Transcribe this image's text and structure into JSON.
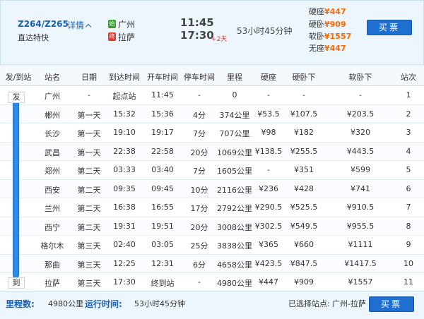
{
  "header": {
    "train_no": "Z264/Z265",
    "detail_link": "详情",
    "train_type": "直达特快",
    "start_badge": "始",
    "end_badge": "终",
    "start_station": "广州",
    "end_station": "拉萨",
    "dep_time": "11:45",
    "arr_time": "17:30",
    "plus_days": "+2天",
    "duration": "53小时45分钟",
    "prices": [
      {
        "label": "硬座",
        "value": "¥447"
      },
      {
        "label": "硬卧",
        "value": "¥909"
      },
      {
        "label": "软卧",
        "value": "¥1557"
      },
      {
        "label": "无座",
        "value": "¥447"
      }
    ],
    "buy_label": "买票"
  },
  "columns": [
    "发/到站",
    "站名",
    "日期",
    "到达时间",
    "开车时间",
    "停车时间",
    "里程",
    "硬座",
    "硬卧下",
    "软卧下",
    "站次"
  ],
  "rail_start": "发",
  "rail_end": "到",
  "rows": [
    {
      "name": "广州",
      "date": "-",
      "arr": "起点站",
      "dep": "11:45",
      "stop": "-",
      "km": "0",
      "yz": "-",
      "yw": "-",
      "rw": "-",
      "no": "1"
    },
    {
      "name": "郴州",
      "date": "第一天",
      "arr": "15:32",
      "dep": "15:36",
      "stop": "4分",
      "km": "374公里",
      "yz": "¥53.5",
      "yw": "¥107.5",
      "rw": "¥203.5",
      "no": "2"
    },
    {
      "name": "长沙",
      "date": "第一天",
      "arr": "19:10",
      "dep": "19:17",
      "stop": "7分",
      "km": "707公里",
      "yz": "¥98",
      "yw": "¥182",
      "rw": "¥320",
      "no": "3"
    },
    {
      "name": "武昌",
      "date": "第一天",
      "arr": "22:38",
      "dep": "22:58",
      "stop": "20分",
      "km": "1069公里",
      "yz": "¥138.5",
      "yw": "¥255.5",
      "rw": "¥443.5",
      "no": "4"
    },
    {
      "name": "郑州",
      "date": "第二天",
      "arr": "03:33",
      "dep": "03:40",
      "stop": "7分",
      "km": "1605公里",
      "yz": "-",
      "yw": "¥351",
      "rw": "¥599",
      "no": "5"
    },
    {
      "name": "西安",
      "date": "第二天",
      "arr": "09:35",
      "dep": "09:45",
      "stop": "10分",
      "km": "2116公里",
      "yz": "¥236",
      "yw": "¥428",
      "rw": "¥741",
      "no": "6"
    },
    {
      "name": "兰州",
      "date": "第二天",
      "arr": "16:38",
      "dep": "16:55",
      "stop": "17分",
      "km": "2792公里",
      "yz": "¥290.5",
      "yw": "¥525.5",
      "rw": "¥910.5",
      "no": "7"
    },
    {
      "name": "西宁",
      "date": "第二天",
      "arr": "19:31",
      "dep": "19:51",
      "stop": "20分",
      "km": "3008公里",
      "yz": "¥302.5",
      "yw": "¥549.5",
      "rw": "¥955.5",
      "no": "8"
    },
    {
      "name": "格尔木",
      "date": "第三天",
      "arr": "02:40",
      "dep": "03:05",
      "stop": "25分",
      "km": "3838公里",
      "yz": "¥365",
      "yw": "¥660",
      "rw": "¥1111",
      "no": "9"
    },
    {
      "name": "那曲",
      "date": "第三天",
      "arr": "12:25",
      "dep": "12:31",
      "stop": "6分",
      "km": "4658公里",
      "yz": "¥423.5",
      "yw": "¥847.5",
      "rw": "¥1417.5",
      "no": "10"
    },
    {
      "name": "拉萨",
      "date": "第三天",
      "arr": "17:30",
      "dep": "终到站",
      "stop": "-",
      "km": "4980公里",
      "yz": "¥447",
      "yw": "¥909",
      "rw": "¥1557",
      "no": "11"
    }
  ],
  "footer": {
    "distance_label": "里程数:",
    "distance_value": "4980公里",
    "runtime_label": "运行时间:",
    "runtime_value": "53小时45分钟",
    "selected_label": "已选择站点:",
    "selected_value": "广州-拉萨",
    "buy_label": "买票"
  },
  "colors": {
    "accent": "#1560b8",
    "price": "#ff6600",
    "button": "#1e6fd0",
    "start_badge": "#33a02c",
    "end_badge": "#e33a2e"
  },
  "icons": {
    "detail_toggle": "chevron-up-icon"
  }
}
